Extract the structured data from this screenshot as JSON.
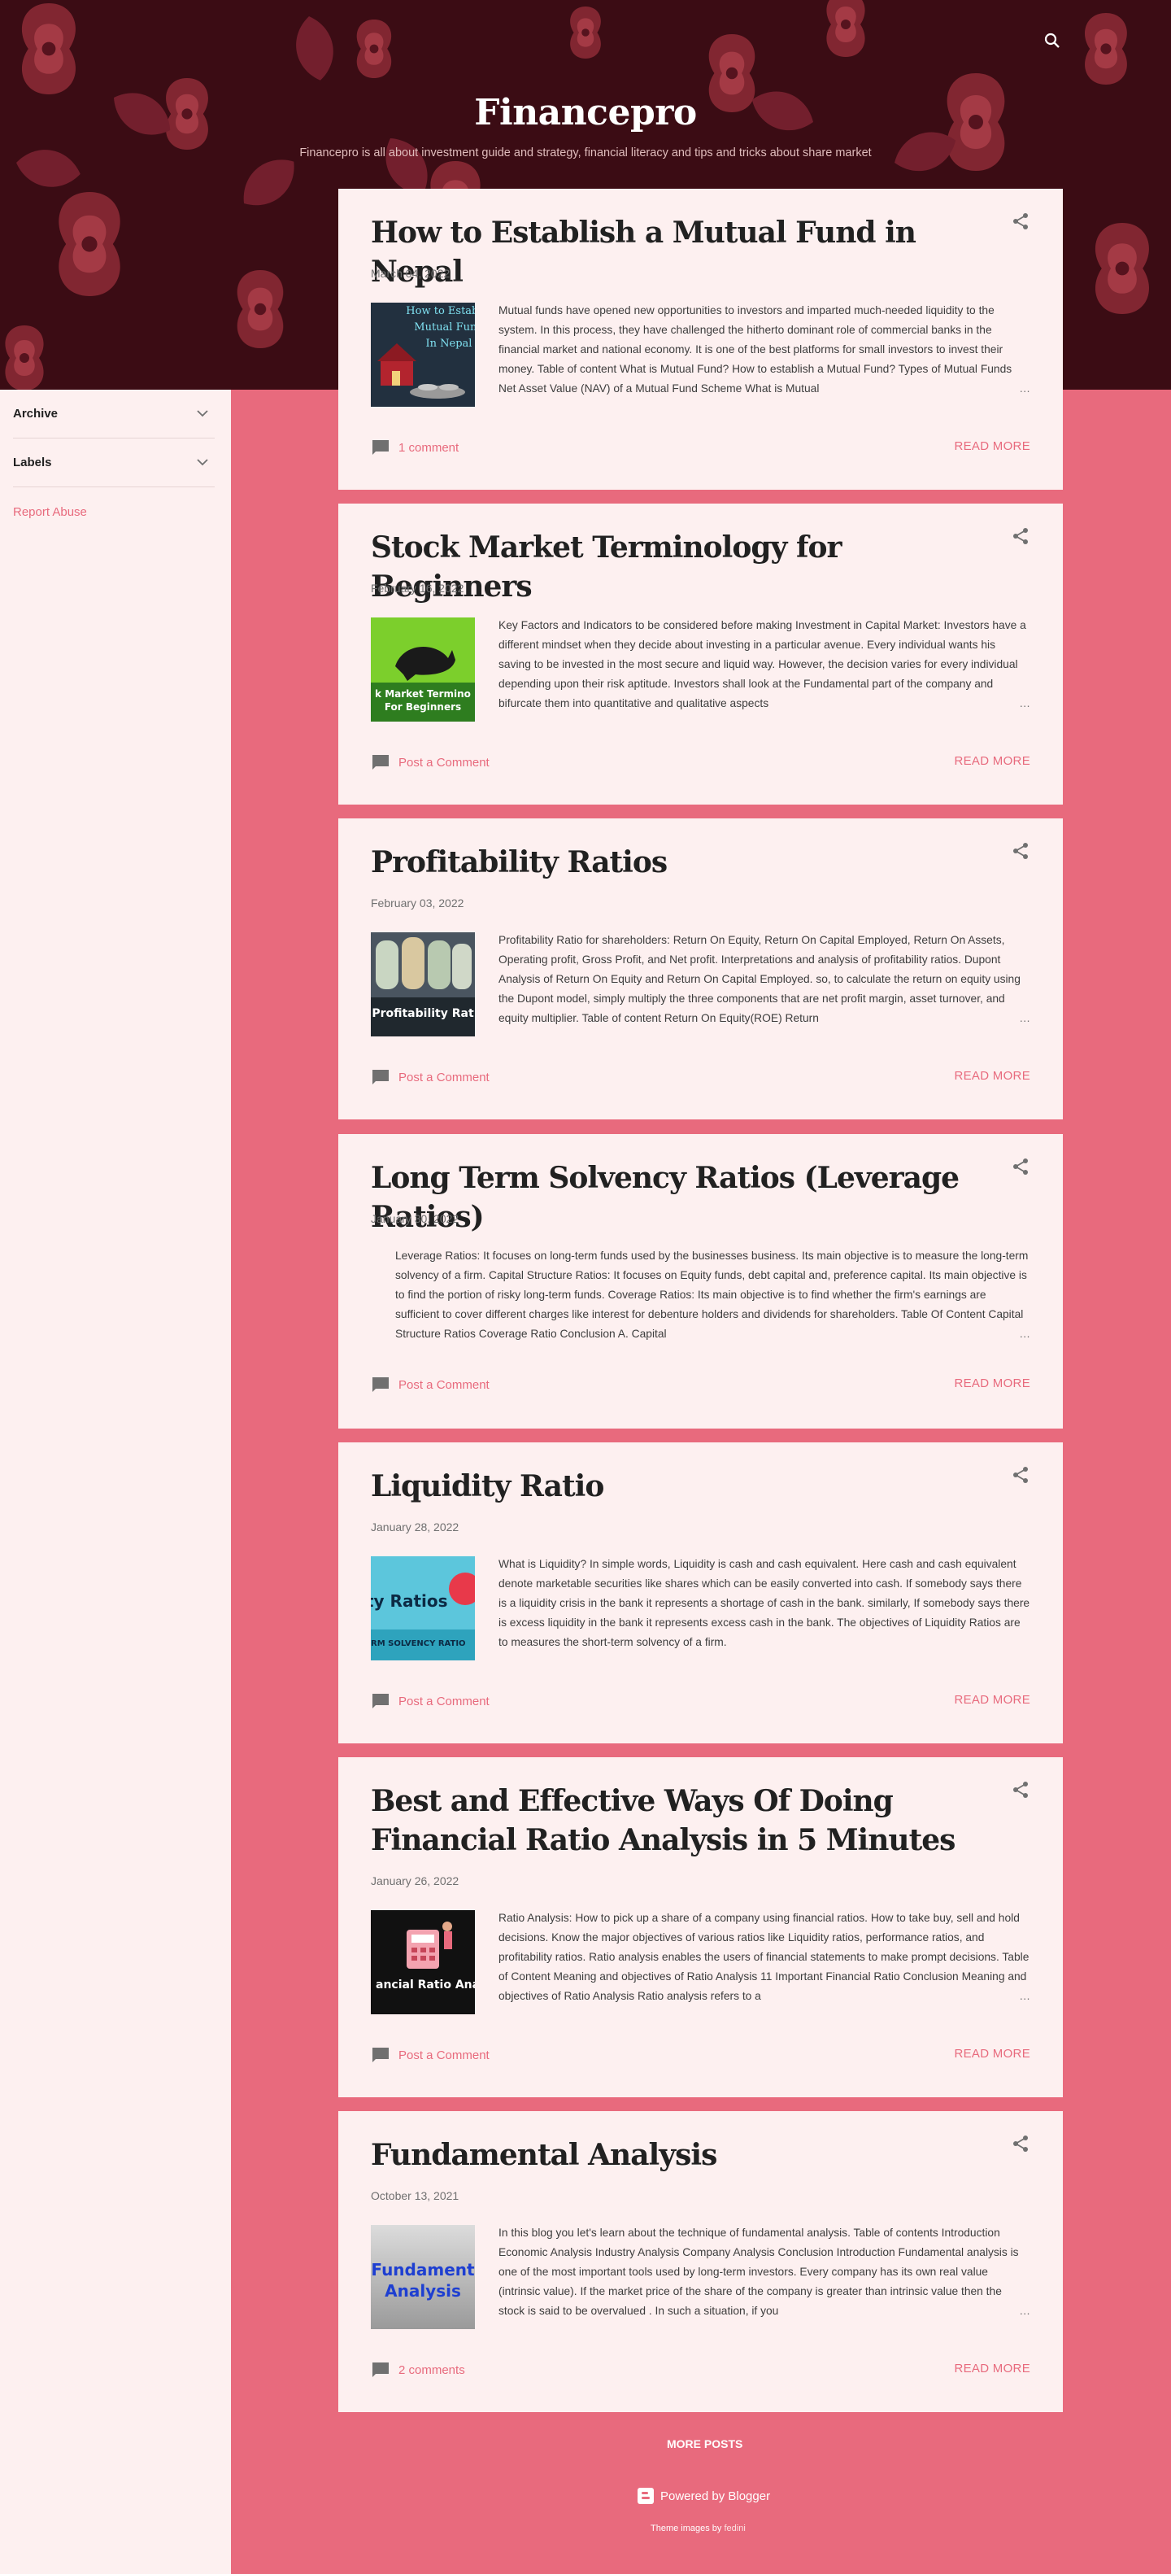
{
  "header": {
    "title": "Financepro",
    "description": "Financepro is all about investment guide and strategy, financial literacy and tips and tricks about share market"
  },
  "sidebar": {
    "archive": "Archive",
    "labels": "Labels",
    "report_abuse": "Report Abuse"
  },
  "posts": [
    {
      "title": "How to Establish a Mutual Fund in Nepal",
      "date": "March 04, 2022",
      "thumb_text": "How to Establish Mutual Fund In Nepal",
      "snippet": "  Mutual funds have opened new opportunities to investors and imparted much-needed liquidity  to the system. In this process, they have challenged the hitherto dominant role of commercial banks  in the financial market and national economy. It is one of the best platforms for small investors to invest their money. Table of content What is Mutual Fund? How to establish a Mutual Fund? Types of Mutual Funds Net Asset Value (NAV) of a Mutual Fund Scheme What is Mutual",
      "comments": "1 comment",
      "read_more": "READ MORE"
    },
    {
      "title": "Stock Market Terminology for Beginners",
      "date": "February 16, 2022",
      "thumb_text": "Stock Market Terminology For Beginners",
      "snippet": "Key Factors and Indicators to be considered before making Investment in Capital Market: Investors have a different mindset when they decide about investing in a particular avenue. Every individual wants his saving to be invested in the most secure and liquid way. However, the decision varies for every individual depending upon their risk aptitude. Investors shall look at the Fundamental  part of the company and bifurcate them into quantitative and qualitative  aspects",
      "comments": "Post a Comment",
      "read_more": "READ MORE"
    },
    {
      "title": "Profitability Ratios",
      "date": "February 03, 2022",
      "thumb_text": "Profitability Ratios",
      "snippet": "  Profitability Ratio for shareholders: Return On Equity, Return On Capital Employed, Return On Assets, Operating profit, Gross Profit, and Net profit. Interpretations and analysis of profitability ratios. Dupont Analysis of Return On Equity and Return On Capital Employed. so, to calculate the return on equity using the Dupont model, simply multiply the three components that are net profit margin, asset turnover, and equity multiplier.   Table of content    Return On Equity(ROE)  Return",
      "comments": "Post a Comment",
      "read_more": "READ MORE"
    },
    {
      "title": "Long Term Solvency Ratios (Leverage Ratios)",
      "date": "January 30, 2022",
      "snippet": "Leverage Ratios: It focuses on long-term funds used by the businesses business. Its main objective is to measure the long-term solvency of a firm. Capital Structure Ratios: It focuses on Equity funds, debt capital and, preference capital. Its main objective is to find the portion of risky long-term funds. Coverage Ratios: Its main objective is to find whether the firm's earnings are sufficient to cover different charges like interest for debenture holders and dividends for shareholders. Table Of  Content Capital Structure Ratios Coverage Ratio Conclusion A. Capital",
      "comments": "Post a Comment",
      "read_more": "READ MORE"
    },
    {
      "title": "Liquidity Ratio",
      "date": "January 28, 2022",
      "thumb_text": "Liquidity Ratios",
      "thumb_sub": "TERM SOLVENCY RATIO",
      "snippet": "What is Liquidity? In simple words, Liquidity is cash and cash equivalent. Here cash and cash equivalent denote marketable securities like shares which can be easily converted into cash. If somebody says there is a liquidity crisis in the bank it represents a shortage of cash in the bank. similarly, If somebody says there is excess liquidity in the bank it represents excess cash in the bank.  The objectives of Liquidity Ratios are to measures the short-term solvency of a firm.",
      "comments": "Post a Comment",
      "read_more": "READ MORE"
    },
    {
      "title": "Best and Effective Ways Of Doing Financial Ratio Analysis in 5 Minutes",
      "date": "January 26, 2022",
      "thumb_text": "Financial Ratio Analysis",
      "snippet": "Ratio Analysis: How to pick up a share of a company using financial ratios. How to take buy, sell and hold decisions. Know the major objectives of various ratios like Liquidity ratios, performance ratios, and profitability ratios. Ratio analysis enables the users of financial statements to make prompt decisions. Table of Content Meaning and objectives of Ratio Analysis 11 Important Financial Ratio Conclusion Meaning and objectives of Ratio Analysis Ratio analysis refers to a",
      "comments": "Post a Comment",
      "read_more": "READ MORE"
    },
    {
      "title": "Fundamental Analysis",
      "date": "October 13, 2021",
      "thumb_text": "Fundamental Analysis",
      "snippet": " In this blog you let's learn about the technique of fundamental analysis. Table of contents Introduction Economic Analysis Industry Analysis Company Analysis Conclusion  Introduction Fundamental analysis is one of the most important tools used by long-term investors. Every company has its own real value (intrinsic value). If the market price of the share of the company is greater than intrinsic value then the stock is said to be overvalued . In such a situation, if you",
      "comments": "2 comments",
      "read_more": "READ MORE"
    }
  ],
  "ellipsis": "…",
  "footer": {
    "more_posts": "MORE POSTS",
    "powered": "Powered by Blogger",
    "theme_prefix": "Theme images by ",
    "theme_author": "fedini"
  },
  "colors": {
    "accent": "#e86a7d",
    "header_bg": "#3b0c14",
    "card_bg": "#fdf0f0"
  }
}
